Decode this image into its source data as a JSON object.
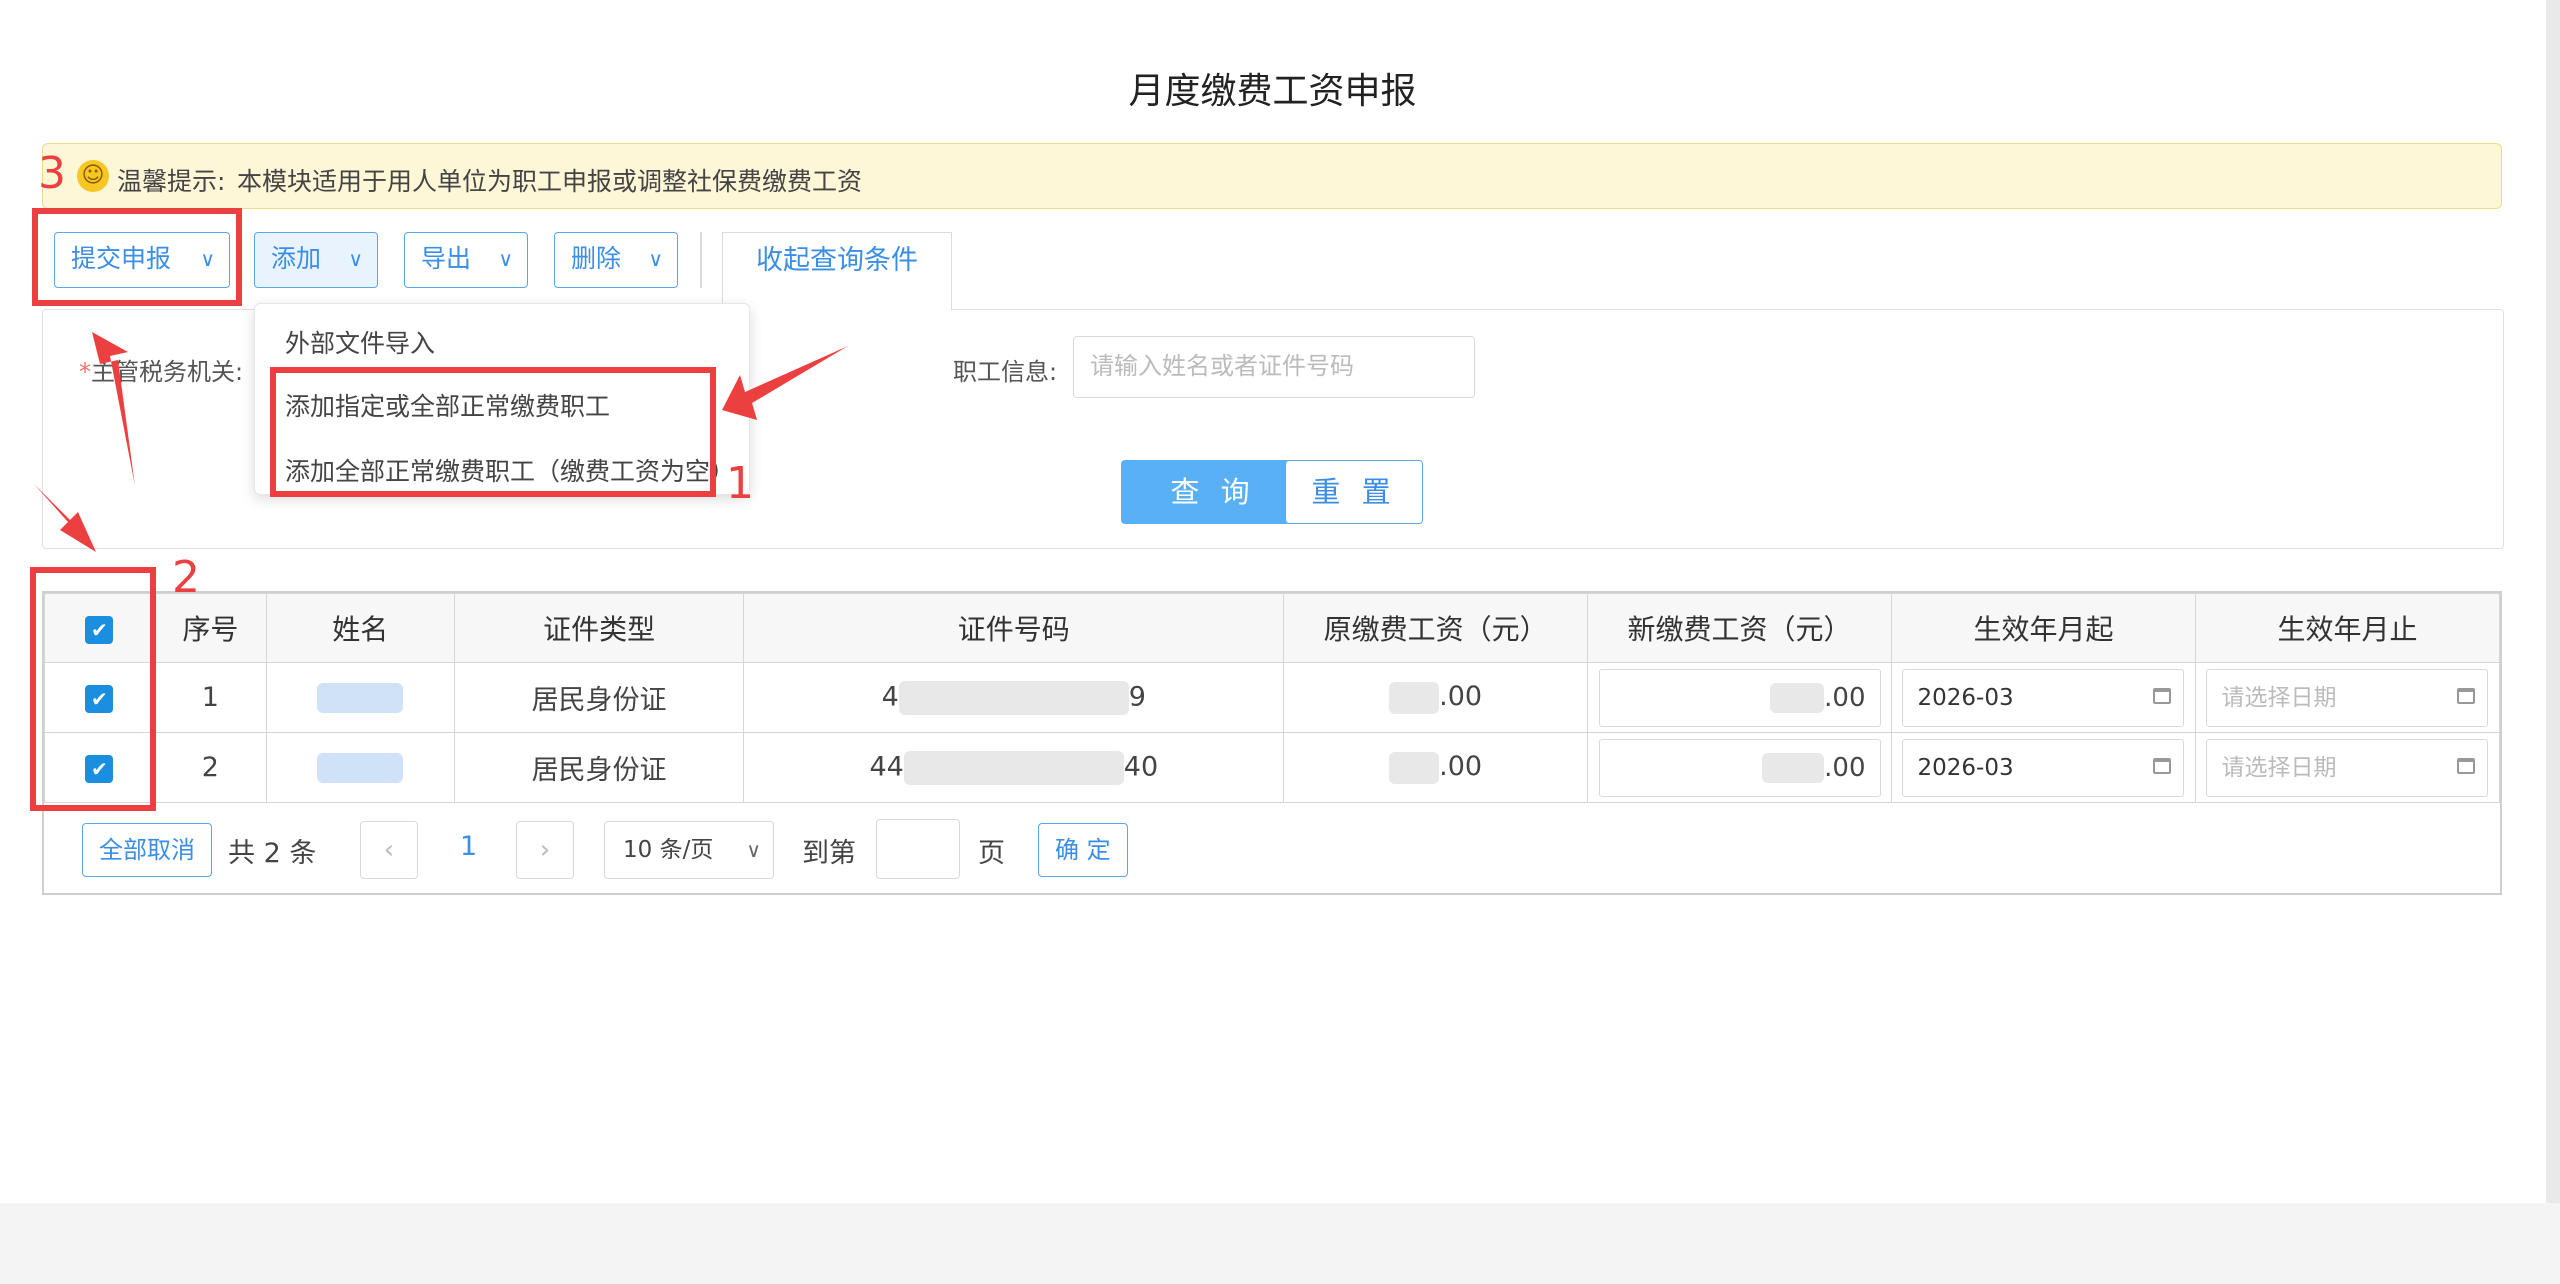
{
  "page": {
    "title": "月度缴费工资申报"
  },
  "tip": {
    "label": "温馨提示:",
    "text": "本模块适用于用人单位为职工申报或调整社保费缴费工资",
    "icon": "smiley-icon"
  },
  "toolbar": {
    "submit": "提交申报",
    "add": "添加",
    "export": "导出",
    "delete": "删除",
    "collapse_query": "收起查询条件"
  },
  "dropdown": {
    "items": [
      "外部文件导入",
      "添加指定或全部正常缴费职工",
      "添加全部正常缴费职工（缴费工资为空）"
    ]
  },
  "search": {
    "tax_label": "主管税务机关:",
    "employee_label": "职工信息:",
    "employee_placeholder": "请输入姓名或者证件号码",
    "query_button": "查 询",
    "reset_button": "重 置"
  },
  "table": {
    "headers": [
      "序号",
      "姓名",
      "证件类型",
      "证件号码",
      "原缴费工资（元）",
      "新缴费工资（元）",
      "生效年月起",
      "生效年月止"
    ],
    "rows": [
      {
        "index": "1",
        "id_type": "居民身份证",
        "id_prefix": "4",
        "id_suffix": "9",
        "old_wage_suffix": ".00",
        "new_wage_suffix": ".00",
        "start": "2026-03",
        "end_placeholder": "请选择日期"
      },
      {
        "index": "2",
        "id_type": "居民身份证",
        "id_prefix": "44",
        "id_suffix": "40",
        "old_wage_suffix": ".00",
        "new_wage_suffix": ".00",
        "start": "2026-03",
        "end_placeholder": "请选择日期"
      }
    ]
  },
  "pager": {
    "cancel_all": "全部取消",
    "total_prefix": "共",
    "total_count": "2",
    "total_suffix": "条",
    "current_page": "1",
    "page_size": "10 条/页",
    "goto_prefix": "到第",
    "goto_suffix": "页",
    "confirm": "确 定"
  },
  "annotations": {
    "label_1": "1",
    "label_2": "2",
    "label_3": "3",
    "color": "#ec4040"
  },
  "colors": {
    "accent": "#3a8ee6",
    "primary_button": "#5ab0f4",
    "tip_background": "#fdf6d7",
    "checkbox": "#1a8fe0"
  }
}
